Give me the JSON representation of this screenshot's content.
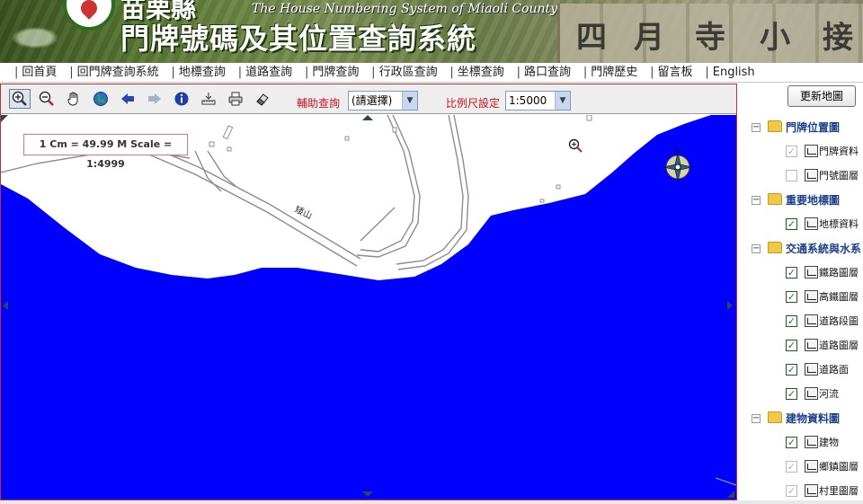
{
  "banner": {
    "title_top": "苗栗縣",
    "title_main": "門牌號碼及其位置查詢系統",
    "title_en": "The House Numbering System of Miaoli County",
    "sign_text": [
      "四",
      "月",
      "寺",
      "小",
      "接"
    ]
  },
  "nav": {
    "items": [
      "回首頁",
      "回門牌查詢系統",
      "地標查詢",
      "道路查詢",
      "門牌查詢",
      "行政區查詢",
      "坐標查詢",
      "路口查詢",
      "門牌歷史",
      "留言板",
      "English"
    ]
  },
  "toolbar": {
    "tools": [
      "zoom-in-icon",
      "zoom-out-icon",
      "pan-hand-icon",
      "full-extent-globe-icon",
      "previous-view-arrow-icon",
      "next-view-arrow-icon",
      "info-icon",
      "measure-icon",
      "print-icon",
      "clear-eraser-icon"
    ],
    "aux_query_label": "輔助查詢",
    "aux_query_value": "(請選擇)",
    "scale_label": "比例尺設定",
    "scale_value": "1:5000"
  },
  "map": {
    "scale_text": "1 Cm = 49.99 M Scale = 1:4999",
    "road_label": "矮山",
    "colors": {
      "water": "#0000ff",
      "land": "#ffffff",
      "road": "#8a8a8a"
    }
  },
  "side": {
    "refresh_label": "更新地圖",
    "groups": [
      {
        "name": "門牌位置圖",
        "layers": [
          {
            "name": "門牌資料",
            "checked": true,
            "enabled": false
          },
          {
            "name": "門號圖層",
            "checked": false,
            "enabled": false
          }
        ]
      },
      {
        "name": "重要地標圖",
        "layers": [
          {
            "name": "地標資料",
            "checked": true,
            "enabled": true
          }
        ]
      },
      {
        "name": "交通系統與水系",
        "layers": [
          {
            "name": "鐵路圖層",
            "checked": true,
            "enabled": true
          },
          {
            "name": "高鐵圖層",
            "checked": true,
            "enabled": true
          },
          {
            "name": "道路段圖",
            "checked": true,
            "enabled": true
          },
          {
            "name": "道路圖層",
            "checked": true,
            "enabled": true
          },
          {
            "name": "道路面",
            "checked": true,
            "enabled": true
          },
          {
            "name": "河流",
            "checked": true,
            "enabled": true
          }
        ]
      },
      {
        "name": "建物資料圖",
        "layers": [
          {
            "name": "建物",
            "checked": true,
            "enabled": true
          },
          {
            "name": "鄉鎮圖層",
            "checked": true,
            "enabled": false
          },
          {
            "name": "村里圖層",
            "checked": true,
            "enabled": false
          }
        ]
      }
    ]
  }
}
